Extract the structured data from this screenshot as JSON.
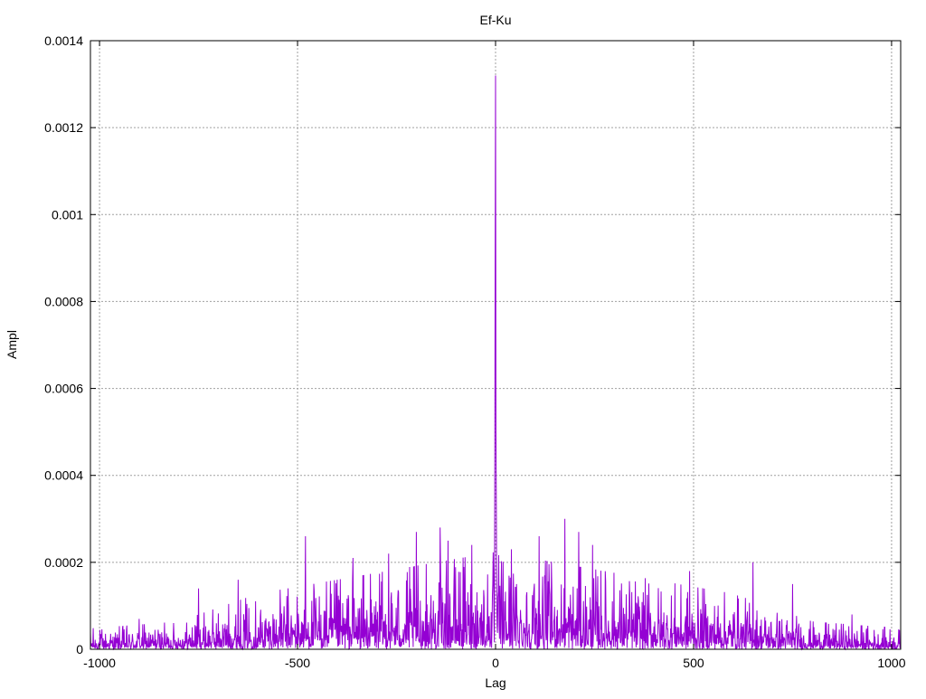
{
  "chart_data": {
    "type": "line",
    "title": "Ef-Ku",
    "xlabel": "Lag",
    "ylabel": "Ampl",
    "xlim": [
      -1023,
      1023
    ],
    "ylim": [
      0,
      0.0014
    ],
    "xticks": [
      -1000,
      -500,
      0,
      500,
      1000
    ],
    "xtick_labels": [
      "-1000",
      "-500",
      "0",
      "500",
      "1000"
    ],
    "yticks": [
      0,
      0.0002,
      0.0004,
      0.0006,
      0.0008,
      0.001,
      0.0012,
      0.0014
    ],
    "ytick_labels": [
      "0",
      "0.0002",
      "0.0004",
      "0.0006",
      "0.0008",
      "0.001",
      "0.0012",
      "0.0014"
    ],
    "grid": true,
    "legend": "none",
    "series": [
      {
        "color": "#9400d3",
        "baseline_envelope": {
          "lag": [
            -1023,
            -800,
            -600,
            -400,
            -200,
            0,
            200,
            400,
            600,
            800,
            1023
          ],
          "mean_ampl": [
            1.5e-05,
            2e-05,
            4e-05,
            5e-05,
            6e-05,
            7e-05,
            6e-05,
            5e-05,
            4e-05,
            2e-05,
            1.5e-05
          ]
        },
        "peaks": [
          {
            "lag": 0,
            "ampl": 0.00132
          },
          {
            "lag": -1,
            "ampl": 0.00089
          },
          {
            "lag": 1,
            "ampl": 0.0005
          },
          {
            "lag": -2,
            "ampl": 0.00037
          },
          {
            "lag": 2,
            "ampl": 0.00032
          },
          {
            "lag": -480,
            "ampl": 0.00026
          },
          {
            "lag": -360,
            "ampl": 0.00021
          },
          {
            "lag": -270,
            "ampl": 0.00022
          },
          {
            "lag": -200,
            "ampl": 0.00027
          },
          {
            "lag": -140,
            "ampl": 0.00028
          },
          {
            "lag": -120,
            "ampl": 0.00025
          },
          {
            "lag": -60,
            "ampl": 0.00024
          },
          {
            "lag": 40,
            "ampl": 0.00023
          },
          {
            "lag": 110,
            "ampl": 0.00026
          },
          {
            "lag": 175,
            "ampl": 0.0003
          },
          {
            "lag": 210,
            "ampl": 0.00027
          },
          {
            "lag": 245,
            "ampl": 0.00024
          },
          {
            "lag": 490,
            "ampl": 0.00018
          },
          {
            "lag": 650,
            "ampl": 0.0002
          },
          {
            "lag": -650,
            "ampl": 0.00016
          },
          {
            "lag": -750,
            "ampl": 0.00014
          },
          {
            "lag": 750,
            "ampl": 0.00015
          },
          {
            "lag": -900,
            "ampl": 7e-05
          },
          {
            "lag": 900,
            "ampl": 8e-05
          }
        ]
      }
    ]
  }
}
